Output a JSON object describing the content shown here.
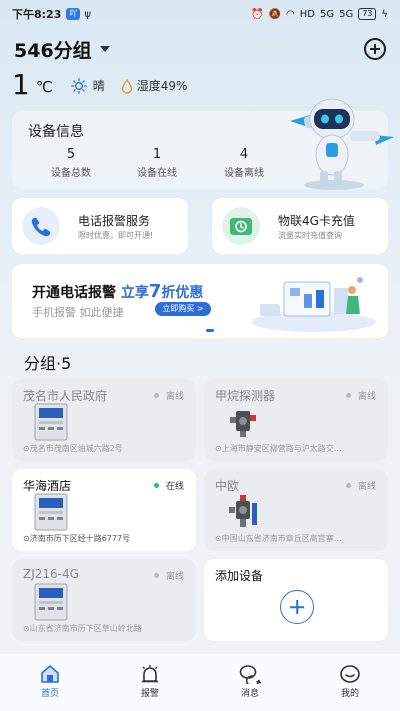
{
  "status_bar": {
    "time": "下午8:23",
    "app_badge": "吖",
    "network": "HD",
    "signal1": "5G",
    "signal2": "5G",
    "battery": "73"
  },
  "header": {
    "group_name": "546分组"
  },
  "weather": {
    "temperature": "1",
    "unit": "℃",
    "condition": "晴",
    "humidity": "湿度49%"
  },
  "device_info": {
    "title": "设备信息",
    "stats": [
      {
        "value": "5",
        "label": "设备总数"
      },
      {
        "value": "1",
        "label": "设备在线"
      },
      {
        "value": "4",
        "label": "设备离线"
      }
    ]
  },
  "services": [
    {
      "title": "电话报警服务",
      "subtitle": "限时优惠，即可开通!"
    },
    {
      "title": "物联4G卡充值",
      "subtitle": "流量实时充值查询"
    }
  ],
  "banner": {
    "line1_prefix": "开通电话报警",
    "line1_highlight_a": "立享",
    "line1_highlight_num": "7",
    "line1_highlight_b": "折优惠",
    "line2": "手机报警  如此便捷",
    "button": "立即购买 >"
  },
  "groups": {
    "heading": "分组·5",
    "devices": [
      {
        "name": "茂名市人民政府",
        "status": "离线",
        "address": "茂名市茂南区油城六路2号",
        "online": false,
        "icon": "gas-alarm-controller-icon"
      },
      {
        "name": "甲烷探测器",
        "status": "离线",
        "address": "上海市静安区柳营路与沪太路交…",
        "online": false,
        "icon": "gas-detector-icon"
      },
      {
        "name": "华海酒店",
        "status": "在线",
        "address": "济南市历下区经十路6777号",
        "online": true,
        "icon": "gas-alarm-controller-icon"
      },
      {
        "name": "中欧",
        "status": "离线",
        "address": "中国山东省济南市章丘区高官寨…",
        "online": false,
        "icon": "gas-detector-icon"
      },
      {
        "name": "ZJ216-4G",
        "status": "离线",
        "address": "山东省济南市历下区草山岭北路",
        "online": false,
        "icon": "gas-alarm-controller-icon"
      }
    ],
    "add_label": "添加设备"
  },
  "nav": [
    {
      "label": "首页",
      "icon": "home-icon",
      "active": true
    },
    {
      "label": "报警",
      "icon": "alarm-icon",
      "active": false
    },
    {
      "label": "消息",
      "icon": "message-icon",
      "active": false
    },
    {
      "label": "我的",
      "icon": "profile-icon",
      "active": false
    }
  ],
  "colors": {
    "accent": "#2d6fd6",
    "online": "#2bc06b"
  }
}
